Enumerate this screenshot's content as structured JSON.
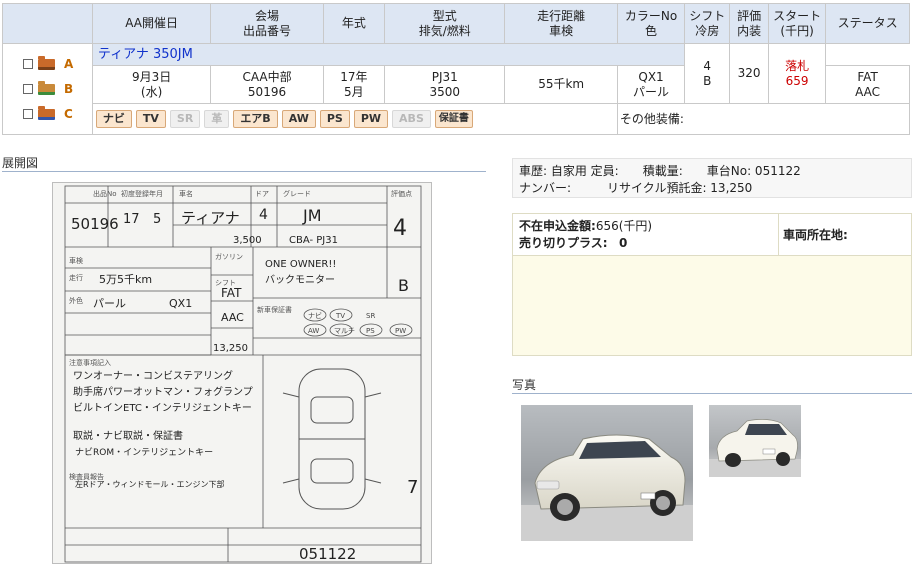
{
  "header": {
    "date": "AA開催日",
    "venue": [
      "会場",
      "出品番号"
    ],
    "year": "年式",
    "model": [
      "型式",
      "排気/燃料"
    ],
    "mileage": [
      "走行距離",
      "車検"
    ],
    "color": [
      "カラーNo",
      "色"
    ],
    "shift": [
      "シフト",
      "冷房"
    ],
    "grade": [
      "評価",
      "内装"
    ],
    "start": [
      "スタート",
      "(千円)"
    ],
    "status": "ステータス"
  },
  "selectors": [
    {
      "label": "A"
    },
    {
      "label": "B"
    },
    {
      "label": "C"
    }
  ],
  "vehicle": {
    "name": "ティアナ 350JM",
    "date": [
      "9月3日",
      "(水)"
    ],
    "venue": [
      "CAA中部",
      "50196"
    ],
    "year": [
      "17年",
      "5月"
    ],
    "model": [
      "PJ31",
      "3500"
    ],
    "mileage": "55千km",
    "color": [
      "QX1",
      "パール"
    ],
    "shift": [
      "FAT",
      "AAC"
    ],
    "grade": [
      "4",
      "B"
    ],
    "start": "320",
    "status": [
      "落札",
      "659"
    ]
  },
  "options": [
    {
      "label": "ナビ",
      "on": true
    },
    {
      "label": "TV",
      "on": true
    },
    {
      "label": "SR",
      "on": false
    },
    {
      "label": "革",
      "on": false
    },
    {
      "label": "エアB",
      "on": true
    },
    {
      "label": "AW",
      "on": true
    },
    {
      "label": "PS",
      "on": true
    },
    {
      "label": "PW",
      "on": true
    },
    {
      "label": "ABS",
      "on": false
    },
    {
      "label": "保証書",
      "on": true
    }
  ],
  "other_equipment": "その他装備:",
  "sections": {
    "sheet_title": "展開図",
    "photo_title": "写真"
  },
  "details": {
    "line1": "車歴: 自家用 定員:　　積載量:　　車台No: 051122",
    "line2": "ナンバー:　　　リサイクル預託金: 13,250"
  },
  "price": {
    "absent_label": "不在申込金額:",
    "absent_value": "656(千円)",
    "plus_label": "売り切りプラス:",
    "plus_value": "0",
    "location_label": "車両所在地:"
  },
  "sheet": {
    "lot": "50196",
    "year": "17",
    "month": "5",
    "model_name": "ティアナ",
    "grade_hand": "JM",
    "door": "4",
    "displacement": "3,500",
    "type": "CBA- PJ31",
    "score": "4",
    "interior": "B",
    "mileage_hand": "5万5千km",
    "color_hand": "パール",
    "color_code": "QX1",
    "shift": "FAT",
    "ac": "AAC",
    "recycle": "13,250",
    "chassis": "051122",
    "sales_point": [
      "ONE OWNER!!",
      "バックモニター"
    ],
    "notes": [
      "ワンオーナー・コンビステアリング",
      "助手席パワーオットマン・フォグランプ",
      "ビルトインETC・インテリジェントキー",
      "取説・ナビ取説・保証書",
      "ナビROM・インテリジェントキー",
      "左Rドア・ウィンドモール・エンジン下部"
    ],
    "labels": [
      "出品No",
      "初度登録年月",
      "車名",
      "ドア",
      "グレード",
      "評価点",
      "車検",
      "走行",
      "外色",
      "シフト",
      "ガソリン",
      "新車保証書",
      "ナビ",
      "TV",
      "SR",
      "AW",
      "PS",
      "PW",
      "注意事項記入",
      "検査員報告"
    ]
  }
}
